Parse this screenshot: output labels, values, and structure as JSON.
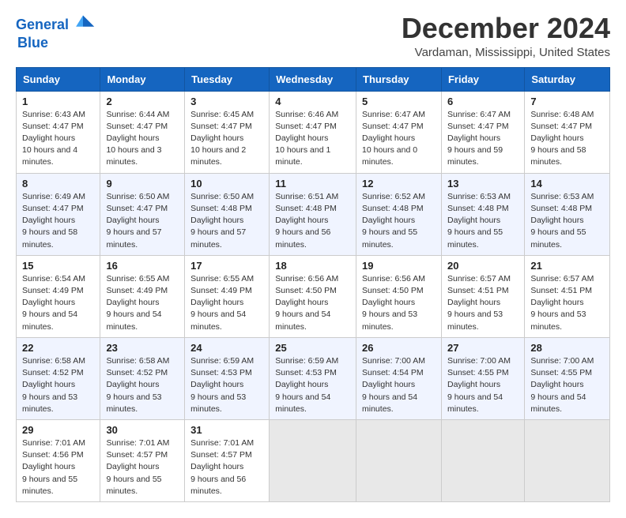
{
  "logo": {
    "line1": "General",
    "line2": "Blue",
    "arrow_color": "#1565c0"
  },
  "title": "December 2024",
  "location": "Vardaman, Mississippi, United States",
  "days_of_week": [
    "Sunday",
    "Monday",
    "Tuesday",
    "Wednesday",
    "Thursday",
    "Friday",
    "Saturday"
  ],
  "weeks": [
    [
      {
        "day": "1",
        "sunrise": "6:43 AM",
        "sunset": "4:47 PM",
        "daylight": "10 hours and 4 minutes."
      },
      {
        "day": "2",
        "sunrise": "6:44 AM",
        "sunset": "4:47 PM",
        "daylight": "10 hours and 3 minutes."
      },
      {
        "day": "3",
        "sunrise": "6:45 AM",
        "sunset": "4:47 PM",
        "daylight": "10 hours and 2 minutes."
      },
      {
        "day": "4",
        "sunrise": "6:46 AM",
        "sunset": "4:47 PM",
        "daylight": "10 hours and 1 minute."
      },
      {
        "day": "5",
        "sunrise": "6:47 AM",
        "sunset": "4:47 PM",
        "daylight": "10 hours and 0 minutes."
      },
      {
        "day": "6",
        "sunrise": "6:47 AM",
        "sunset": "4:47 PM",
        "daylight": "9 hours and 59 minutes."
      },
      {
        "day": "7",
        "sunrise": "6:48 AM",
        "sunset": "4:47 PM",
        "daylight": "9 hours and 58 minutes."
      }
    ],
    [
      {
        "day": "8",
        "sunrise": "6:49 AM",
        "sunset": "4:47 PM",
        "daylight": "9 hours and 58 minutes."
      },
      {
        "day": "9",
        "sunrise": "6:50 AM",
        "sunset": "4:47 PM",
        "daylight": "9 hours and 57 minutes."
      },
      {
        "day": "10",
        "sunrise": "6:50 AM",
        "sunset": "4:48 PM",
        "daylight": "9 hours and 57 minutes."
      },
      {
        "day": "11",
        "sunrise": "6:51 AM",
        "sunset": "4:48 PM",
        "daylight": "9 hours and 56 minutes."
      },
      {
        "day": "12",
        "sunrise": "6:52 AM",
        "sunset": "4:48 PM",
        "daylight": "9 hours and 55 minutes."
      },
      {
        "day": "13",
        "sunrise": "6:53 AM",
        "sunset": "4:48 PM",
        "daylight": "9 hours and 55 minutes."
      },
      {
        "day": "14",
        "sunrise": "6:53 AM",
        "sunset": "4:48 PM",
        "daylight": "9 hours and 55 minutes."
      }
    ],
    [
      {
        "day": "15",
        "sunrise": "6:54 AM",
        "sunset": "4:49 PM",
        "daylight": "9 hours and 54 minutes."
      },
      {
        "day": "16",
        "sunrise": "6:55 AM",
        "sunset": "4:49 PM",
        "daylight": "9 hours and 54 minutes."
      },
      {
        "day": "17",
        "sunrise": "6:55 AM",
        "sunset": "4:49 PM",
        "daylight": "9 hours and 54 minutes."
      },
      {
        "day": "18",
        "sunrise": "6:56 AM",
        "sunset": "4:50 PM",
        "daylight": "9 hours and 54 minutes."
      },
      {
        "day": "19",
        "sunrise": "6:56 AM",
        "sunset": "4:50 PM",
        "daylight": "9 hours and 53 minutes."
      },
      {
        "day": "20",
        "sunrise": "6:57 AM",
        "sunset": "4:51 PM",
        "daylight": "9 hours and 53 minutes."
      },
      {
        "day": "21",
        "sunrise": "6:57 AM",
        "sunset": "4:51 PM",
        "daylight": "9 hours and 53 minutes."
      }
    ],
    [
      {
        "day": "22",
        "sunrise": "6:58 AM",
        "sunset": "4:52 PM",
        "daylight": "9 hours and 53 minutes."
      },
      {
        "day": "23",
        "sunrise": "6:58 AM",
        "sunset": "4:52 PM",
        "daylight": "9 hours and 53 minutes."
      },
      {
        "day": "24",
        "sunrise": "6:59 AM",
        "sunset": "4:53 PM",
        "daylight": "9 hours and 53 minutes."
      },
      {
        "day": "25",
        "sunrise": "6:59 AM",
        "sunset": "4:53 PM",
        "daylight": "9 hours and 54 minutes."
      },
      {
        "day": "26",
        "sunrise": "7:00 AM",
        "sunset": "4:54 PM",
        "daylight": "9 hours and 54 minutes."
      },
      {
        "day": "27",
        "sunrise": "7:00 AM",
        "sunset": "4:55 PM",
        "daylight": "9 hours and 54 minutes."
      },
      {
        "day": "28",
        "sunrise": "7:00 AM",
        "sunset": "4:55 PM",
        "daylight": "9 hours and 54 minutes."
      }
    ],
    [
      {
        "day": "29",
        "sunrise": "7:01 AM",
        "sunset": "4:56 PM",
        "daylight": "9 hours and 55 minutes."
      },
      {
        "day": "30",
        "sunrise": "7:01 AM",
        "sunset": "4:57 PM",
        "daylight": "9 hours and 55 minutes."
      },
      {
        "day": "31",
        "sunrise": "7:01 AM",
        "sunset": "4:57 PM",
        "daylight": "9 hours and 56 minutes."
      },
      null,
      null,
      null,
      null
    ]
  ]
}
